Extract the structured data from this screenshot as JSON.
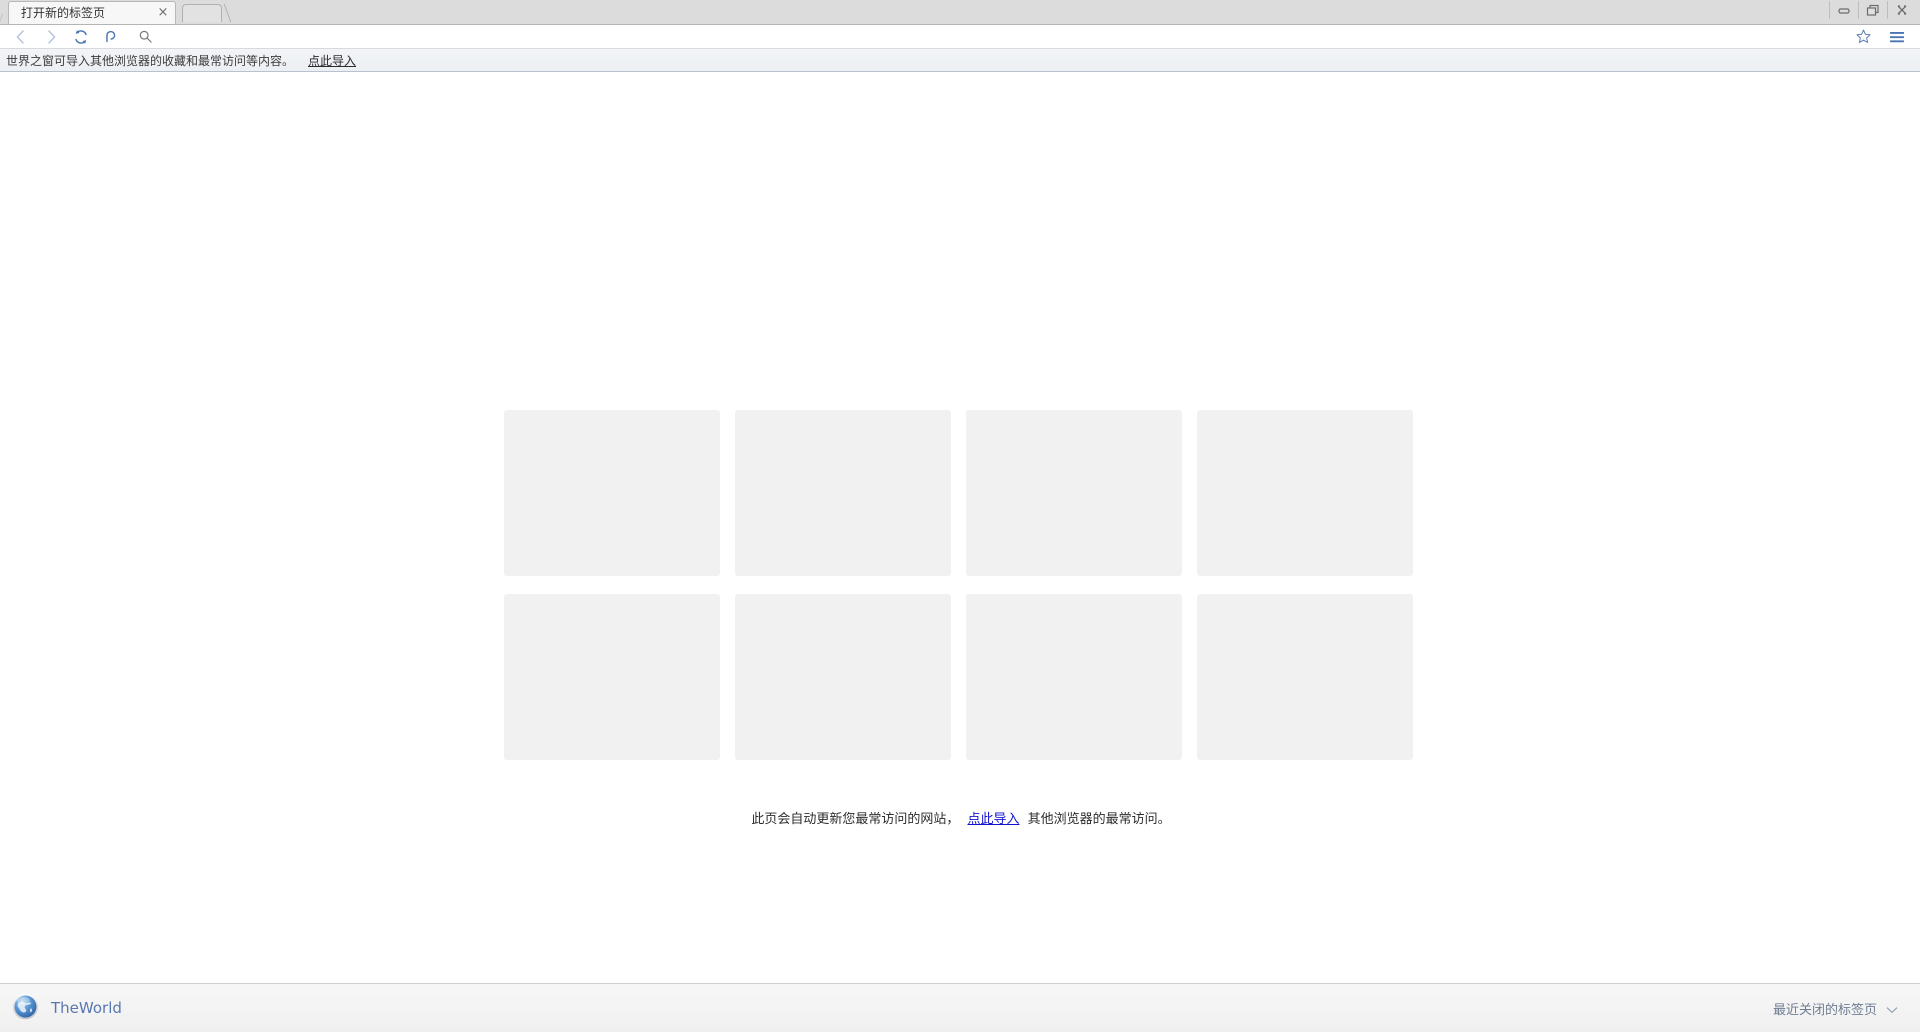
{
  "window": {
    "controls": [
      {
        "name": "minimize-button",
        "glyph": "minimize-icon"
      },
      {
        "name": "restore-button",
        "glyph": "restore-icon"
      },
      {
        "name": "close-button",
        "glyph": "close-icon"
      }
    ]
  },
  "tabs": [
    {
      "title": "打开新的标签页",
      "close_label": "×",
      "active": true
    }
  ],
  "new_tab_button": {
    "tooltip": "新建标签页"
  },
  "toolbar": {
    "back": {
      "label": "后退",
      "icon": "chevron-left-icon",
      "disabled": true
    },
    "forward": {
      "label": "前进",
      "icon": "chevron-right-icon",
      "disabled": true
    },
    "reload": {
      "label": "刷新",
      "icon": "reload-icon"
    },
    "undo": {
      "label": "撤销",
      "icon": "undo-icon"
    },
    "address": {
      "value": "",
      "placeholder": "",
      "icon": "search-icon"
    },
    "favorite": {
      "label": "收藏",
      "icon": "star-icon"
    },
    "menu": {
      "label": "菜单",
      "icon": "hamburger-menu-icon"
    }
  },
  "notification": {
    "text": "世界之窗可导入其他浏览器的收藏和最常访问等内容。",
    "link": "点此导入"
  },
  "speed_dial": {
    "tiles": [
      {
        "id": 1,
        "label": ""
      },
      {
        "id": 2,
        "label": ""
      },
      {
        "id": 3,
        "label": ""
      },
      {
        "id": 4,
        "label": ""
      },
      {
        "id": 5,
        "label": ""
      },
      {
        "id": 6,
        "label": ""
      },
      {
        "id": 7,
        "label": ""
      },
      {
        "id": 8,
        "label": ""
      }
    ],
    "caption_before": "此页会自动更新您最常访问的网站，",
    "caption_link": "点此导入",
    "caption_after": "其他浏览器的最常访问。"
  },
  "status_bar": {
    "brand": "TheWorld",
    "brand_icon": "globe-icon",
    "recent_tabs_label": "最近关闭的标签页",
    "recent_tabs_icon": "chevron-down-icon"
  },
  "colors": {
    "tile": "#f1f1f1",
    "link": "#1414d0",
    "brand_text": "#5a78b0",
    "toolbar_icon": "#5b7db1"
  }
}
